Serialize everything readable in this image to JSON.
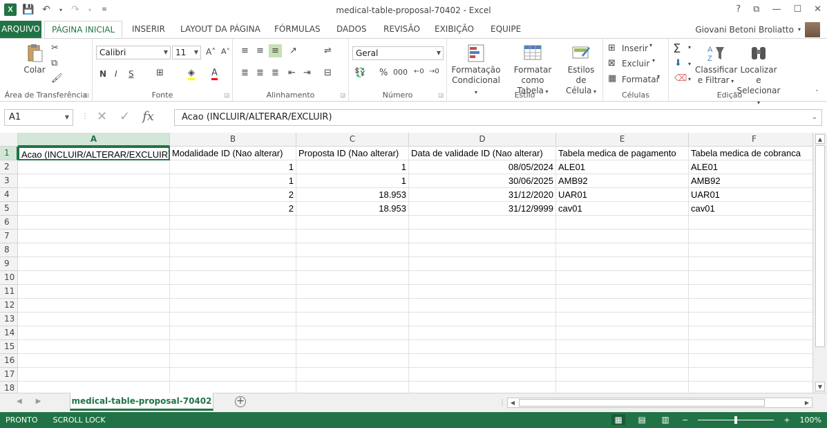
{
  "window": {
    "title": "medical-table-proposal-70402 - Excel",
    "app_logo": "X",
    "controls": [
      "?",
      "⧉",
      "—",
      "☐",
      "✕"
    ]
  },
  "ribbon_tabs": {
    "file": "ARQUIVO",
    "tabs": [
      "PÁGINA INICIAL",
      "INSERIR",
      "LAYOUT DA PÁGINA",
      "FÓRMULAS",
      "DADOS",
      "REVISÃO",
      "EXIBIÇÃO",
      "EQUIPE"
    ],
    "active": "PÁGINA INICIAL",
    "user": "Giovani Betoni Broliatto"
  },
  "ribbon": {
    "clipboard": {
      "label": "Área de Transferência",
      "paste": "Colar"
    },
    "font": {
      "label": "Fonte",
      "family": "Calibri",
      "size": "11",
      "bold": "N",
      "italic": "I",
      "underline": "S"
    },
    "alignment": {
      "label": "Alinhamento"
    },
    "number": {
      "label": "Número",
      "format": "Geral"
    },
    "styles": {
      "label": "Estilo",
      "conditional": [
        "Formatação",
        "Condicional"
      ],
      "format_table": [
        "Formatar como",
        "Tabela"
      ],
      "cell_styles": [
        "Estilos de",
        "Célula"
      ]
    },
    "cells": {
      "label": "Células",
      "insert": "Inserir",
      "delete": "Excluir",
      "format": "Formatar"
    },
    "editing": {
      "label": "Edição",
      "sort": [
        "Classificar",
        "e Filtrar"
      ],
      "find": [
        "Localizar e",
        "Selecionar"
      ]
    }
  },
  "formula_bar": {
    "name_box": "A1",
    "fx": "fx",
    "content": "Acao (INCLUIR/ALTERAR/EXCLUIR)"
  },
  "sheet": {
    "columns": [
      "A",
      "B",
      "C",
      "D",
      "E",
      "F"
    ],
    "row_numbers": [
      "1",
      "2",
      "3",
      "4",
      "5",
      "6",
      "7",
      "8",
      "9",
      "10",
      "11",
      "12",
      "13",
      "14",
      "15",
      "16",
      "17",
      "18"
    ],
    "rows": [
      [
        "Acao (INCLUIR/ALTERAR/EXCLUIR)",
        "Modalidade ID (Nao alterar)",
        "Proposta ID (Nao alterar)",
        "Data de validade ID (Nao alterar)",
        "Tabela medica de pagamento",
        "Tabela medica de cobranca"
      ],
      [
        "",
        "1",
        "1",
        "08/05/2024",
        "ALE01",
        "ALE01"
      ],
      [
        "",
        "1",
        "1",
        "30/06/2025",
        "AMB92",
        "AMB92"
      ],
      [
        "",
        "2",
        "18.953",
        "31/12/2020",
        "UAR01",
        "UAR01"
      ],
      [
        "",
        "2",
        "18.953",
        "31/12/9999",
        "cav01",
        "cav01"
      ]
    ]
  },
  "sheet_tabs": {
    "active": "medical-table-proposal-70402",
    "add": "+"
  },
  "status_bar": {
    "left": [
      "PRONTO",
      "SCROLL LOCK"
    ],
    "zoom": "100%"
  }
}
